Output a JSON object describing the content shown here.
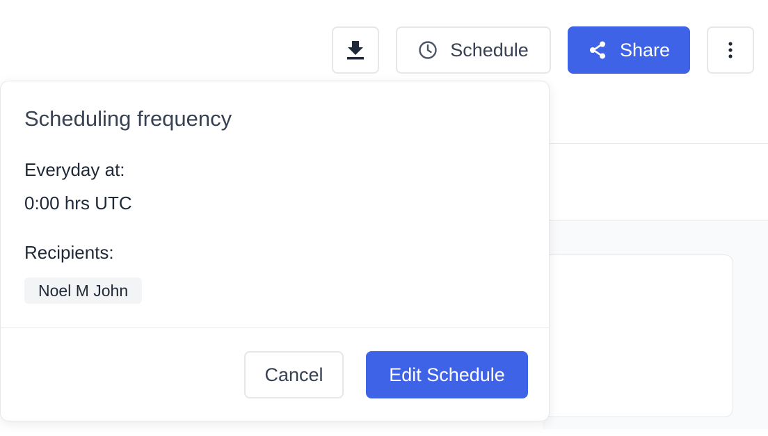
{
  "toolbar": {
    "schedule_label": "Schedule",
    "share_label": "Share"
  },
  "popover": {
    "title": "Scheduling frequency",
    "frequency_label": "Everyday at:",
    "time_value": "0:00 hrs UTC",
    "recipients_label": "Recipients:",
    "recipients": [
      "Noel M John"
    ],
    "cancel_label": "Cancel",
    "edit_label": "Edit Schedule"
  },
  "icons": {
    "download": "download-icon",
    "schedule": "clock-icon",
    "share": "share-icon",
    "more": "more-vertical-icon"
  },
  "colors": {
    "primary": "#3f63e6",
    "border": "#e5e7eb",
    "chip_bg": "#f3f4f6"
  }
}
